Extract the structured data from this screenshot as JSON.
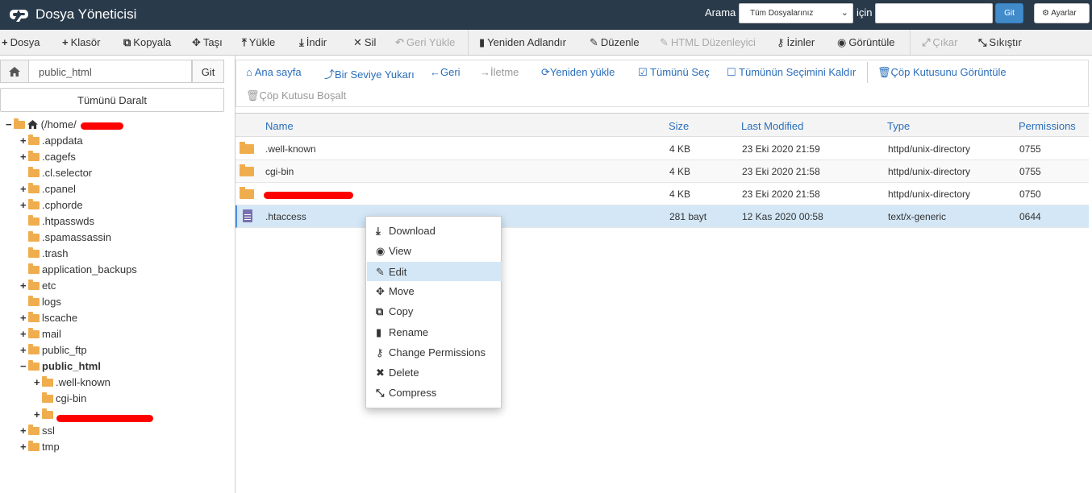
{
  "header": {
    "title": "Dosya Yöneticisi",
    "search_label": "Arama",
    "search_scope": "Tüm Dosyalarınız",
    "for_label": "için",
    "go_label": "Git",
    "settings_label": "Ayarlar"
  },
  "toolbar": {
    "items": [
      {
        "label": "Dosya",
        "icon": "plus-icon"
      },
      {
        "label": "Klasör",
        "icon": "plus-icon"
      },
      {
        "label": "Kopyala",
        "icon": "copy-icon"
      },
      {
        "label": "Taşı",
        "icon": "move-icon"
      },
      {
        "label": "Yükle",
        "icon": "upload-icon"
      },
      {
        "label": "İndir",
        "icon": "download-icon"
      },
      {
        "label": "Sil",
        "icon": "delete-icon"
      },
      {
        "label": "Geri Yükle",
        "icon": "undo-icon"
      },
      {
        "label": "Yeniden Adlandır",
        "icon": "file-icon"
      },
      {
        "label": "Düzenle",
        "icon": "pencil-icon"
      },
      {
        "label": "HTML Düzenleyici",
        "icon": "html-edit-icon"
      },
      {
        "label": "İzinler",
        "icon": "key-icon"
      },
      {
        "label": "Görüntüle",
        "icon": "eye-icon"
      },
      {
        "label": "Çıkar",
        "icon": "expand-icon"
      },
      {
        "label": "Sıkıştır",
        "icon": "compress-icon"
      }
    ]
  },
  "sidebar": {
    "path": "public_html",
    "go_label": "Git",
    "collapse_label": "Tümünü Daralt",
    "root_label": "(/home/",
    "tree": [
      {
        "label": ".appdata"
      },
      {
        "label": ".cagefs"
      },
      {
        "label": ".cl.selector"
      },
      {
        "label": ".cpanel"
      },
      {
        "label": ".cphorde"
      },
      {
        "label": ".htpasswds"
      },
      {
        "label": ".spamassassin"
      },
      {
        "label": ".trash"
      },
      {
        "label": "application_backups"
      },
      {
        "label": "etc"
      },
      {
        "label": "logs"
      },
      {
        "label": "lscache"
      },
      {
        "label": "mail"
      },
      {
        "label": "public_ftp"
      },
      {
        "label": "public_html"
      },
      {
        "label": ".well-known"
      },
      {
        "label": "cgi-bin"
      },
      {
        "label": ""
      },
      {
        "label": "ssl"
      },
      {
        "label": "tmp"
      }
    ]
  },
  "actions": {
    "home": "Ana sayfa",
    "up": "Bir Seviye Yukarı",
    "back": "Geri",
    "forward": "İletme",
    "reload": "Yeniden yükle",
    "select_all": "Tümünü Seç",
    "unselect_all": "Tümünün Seçimini Kaldır",
    "view_trash": "Çöp Kutusunu Görüntüle",
    "empty_trash": "Çöp Kutusu Boşalt"
  },
  "table": {
    "columns": [
      "Name",
      "Size",
      "Last Modified",
      "Type",
      "Permissions"
    ],
    "rows": [
      {
        "name": ".well-known",
        "size": "4 KB",
        "modified": "23 Eki 2020 21:59",
        "type": "httpd/unix-directory",
        "perms": "0755"
      },
      {
        "name": "cgi-bin",
        "size": "4 KB",
        "modified": "23 Eki 2020 21:58",
        "type": "httpd/unix-directory",
        "perms": "0755"
      },
      {
        "name": "",
        "size": "4 KB",
        "modified": "23 Eki 2020 21:58",
        "type": "httpd/unix-directory",
        "perms": "0750"
      },
      {
        "name": ".htaccess",
        "size": "281 bayt",
        "modified": "12 Kas 2020 00:58",
        "type": "text/x-generic",
        "perms": "0644"
      }
    ]
  },
  "context_menu": {
    "items": [
      "Download",
      "View",
      "Edit",
      "Move",
      "Copy",
      "Rename",
      "Change Permissions",
      "Delete",
      "Compress"
    ]
  }
}
